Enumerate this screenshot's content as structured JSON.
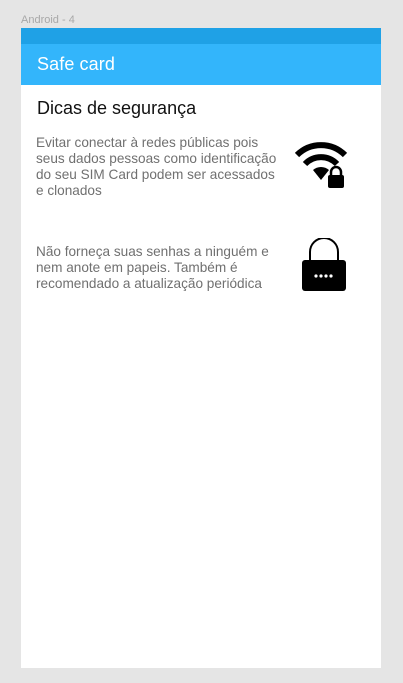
{
  "frame": {
    "label": "Android - 4"
  },
  "app_bar": {
    "title": "Safe card"
  },
  "section": {
    "heading": "Dicas de segurança"
  },
  "tips": [
    {
      "text": "Evitar conectar à redes públicas pois seus dados pessoas como identificação do seu SIM Card podem ser acessados e clonados",
      "icon": "wifi-lock-icon"
    },
    {
      "text": "Não forneça suas senhas a ninguém e nem anote em papeis. Também é recomendado a atualização periódica",
      "icon": "password-lock-icon"
    }
  ],
  "colors": {
    "status_bar": "#1fa1e6",
    "app_bar": "#33b5fb",
    "background": "#e5e5e5"
  }
}
